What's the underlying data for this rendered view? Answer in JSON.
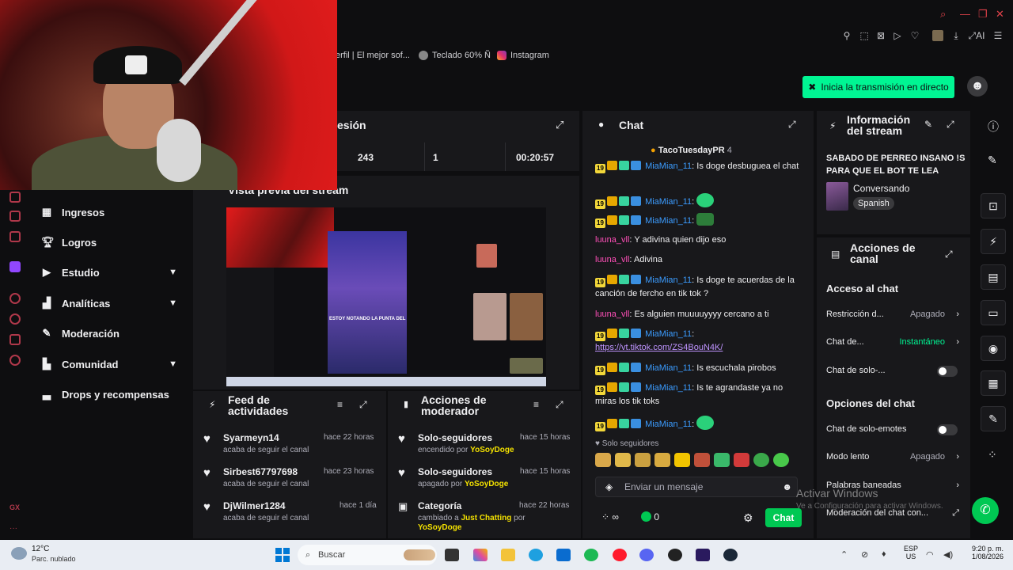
{
  "browser": {
    "bookmarks": [
      "erfil | El mejor sof...",
      "Teclado 60% Ñ",
      "Instagram"
    ]
  },
  "header": {
    "go_live": "Inicia la transmisión en directo"
  },
  "sidebar": {
    "items": [
      {
        "label": "Ingresos",
        "has_chevron": false
      },
      {
        "label": "Logros",
        "has_chevron": false
      },
      {
        "label": "Estudio",
        "has_chevron": true
      },
      {
        "label": "Analíticas",
        "has_chevron": true
      },
      {
        "label": "Moderación",
        "has_chevron": false
      },
      {
        "label": "Comunidad",
        "has_chevron": true
      },
      {
        "label": "Drops y recompensas",
        "has_chevron": false
      }
    ]
  },
  "session": {
    "title": "esión",
    "stats": [
      "243",
      "1",
      "00:20:57"
    ]
  },
  "preview": {
    "title": "Vista previa del stream",
    "overlay_text": "ESTOY NOTANDO LA PUNTA DEL"
  },
  "feed": {
    "title": "Feed de actividades",
    "items": [
      {
        "name": "Syarmeyn14",
        "action": "acaba de seguir el canal",
        "time": "hace 22 horas"
      },
      {
        "name": "Sirbest67797698",
        "action": "acaba de seguir el canal",
        "time": "hace 23 horas"
      },
      {
        "name": "DjWilmer1284",
        "action": "acaba de seguir el canal",
        "time": "hace 1 día"
      }
    ]
  },
  "mod_actions": {
    "title": "Acciones de moderador",
    "items": [
      {
        "name": "Solo-seguidores",
        "action_prefix": "encendido por",
        "by": "YoSoyDoge",
        "time": "hace 15 horas"
      },
      {
        "name": "Solo-seguidores",
        "action_prefix": "apagado por",
        "by": "YoSoyDoge",
        "time": "hace 15 horas"
      },
      {
        "name": "Categoría",
        "action_prefix": "cambiado a",
        "category": "Just Chatting",
        "by_prefix": "por",
        "by": "YoSoyDoge",
        "time": "hace 22 horas"
      }
    ]
  },
  "chat": {
    "title": "Chat",
    "pinned_user": "TacoTuesdayPR",
    "pinned_count": "4",
    "messages": [
      {
        "user": "MiaMian_11",
        "text": "Is doge desbuguea el chat"
      },
      {
        "user": "MiaMian_11",
        "text": ""
      },
      {
        "user": "MiaMian_11",
        "text": ""
      },
      {
        "user": "luuna_vll",
        "text": "Y adivina quien dijo eso"
      },
      {
        "user": "luuna_vll",
        "text": "Adivina"
      },
      {
        "user": "MiaMian_11",
        "text": "Is doge te acuerdas de la canción de fercho en tik tok ?"
      },
      {
        "user": "luuna_vll",
        "text": "Es alguien muuuuyyyy cercano a ti"
      },
      {
        "user": "MiaMian_11",
        "text": "https://vt.tiktok.com/ZS4BouN4K/"
      },
      {
        "user": "MiaMian_11",
        "text": "Is escuchala pirobos"
      },
      {
        "user": "MiaMian_11",
        "text": "Is te agrandaste ya no miras los tik toks"
      },
      {
        "user": "MiaMian_11",
        "text": ""
      }
    ],
    "mode_label": "Solo seguidores",
    "input_placeholder": "Enviar un mensaje",
    "points": "0",
    "send_label": "Chat"
  },
  "stream_info": {
    "title": "Información del stream",
    "stream_title": "SABADO DE PERREO INSANO !S PARA QUE EL BOT TE LEA",
    "category": "Conversando",
    "language": "Spanish"
  },
  "channel_actions": {
    "title": "Acciones de canal",
    "section1": "Acceso al chat",
    "rows1": [
      {
        "label": "Restricción d...",
        "value": "Apagado",
        "type": "chevron"
      },
      {
        "label": "Chat de...",
        "value": "Instantáneo",
        "type": "chevron"
      },
      {
        "label": "Chat de solo-...",
        "value": "",
        "type": "toggle"
      }
    ],
    "section2": "Opciones del chat",
    "rows2": [
      {
        "label": "Chat de solo-emotes",
        "value": "",
        "type": "toggle"
      },
      {
        "label": "Modo lento",
        "value": "Apagado",
        "type": "chevron"
      },
      {
        "label": "Palabras baneadas",
        "value": "",
        "type": "chevron"
      },
      {
        "label": "Moderación del chat con...",
        "value": "",
        "type": "link"
      }
    ]
  },
  "watermark": {
    "line1": "Activar Windows",
    "line2": "Ve a Configuración para activar Windows."
  },
  "taskbar": {
    "weather_temp": "12°C",
    "weather_desc": "Parc. nublado",
    "search": "Buscar",
    "lang1": "ESP",
    "lang2": "US",
    "time": "9:20 p. m.",
    "date": "1/08/2026"
  },
  "colors": {
    "accent_green": "#00f593",
    "twitch_purple": "#bf94ff",
    "mod_yellow": "#f3e100"
  }
}
